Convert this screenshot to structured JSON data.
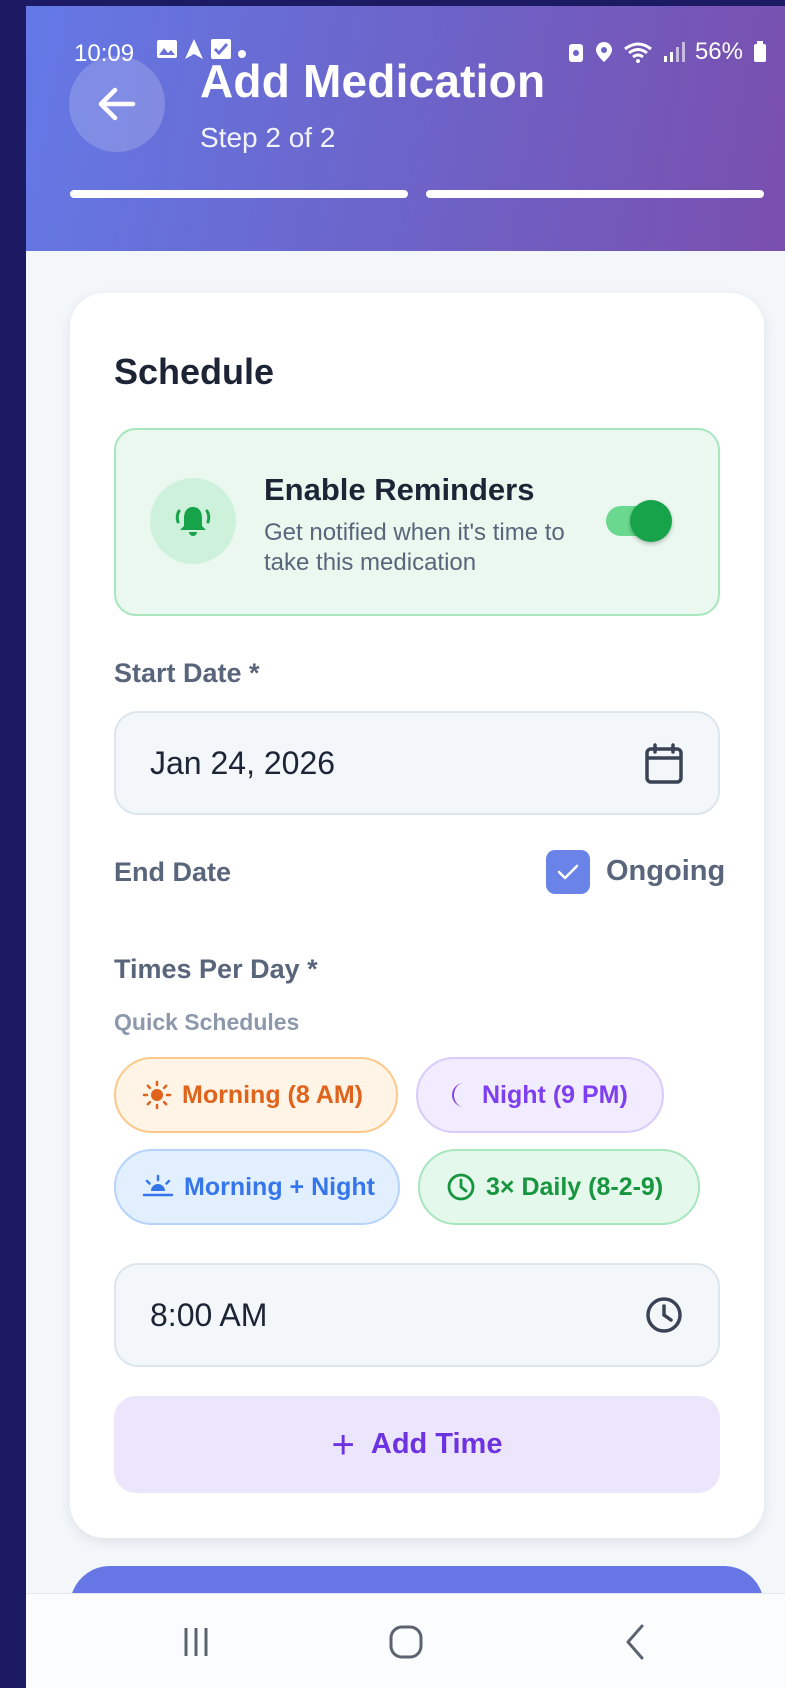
{
  "status_bar": {
    "time": "10:09",
    "battery": "56%"
  },
  "header": {
    "title": "Add Medication",
    "subtitle": "Step 2 of 2",
    "step_current": 2,
    "step_total": 2
  },
  "schedule": {
    "title": "Schedule",
    "reminders": {
      "title": "Enable Reminders",
      "description": "Get notified when it's time to take this medication",
      "enabled": true
    },
    "start_date": {
      "label": "Start Date *",
      "value": "Jan 24, 2026"
    },
    "end_date": {
      "label": "End Date",
      "ongoing_label": "Ongoing",
      "ongoing_checked": true
    },
    "times": {
      "label": "Times Per Day *",
      "quick_label": "Quick Schedules",
      "chips": [
        {
          "label": "Morning (8 AM)",
          "icon": "sun-icon"
        },
        {
          "label": "Night (9 PM)",
          "icon": "moon-icon"
        },
        {
          "label": "Morning + Night",
          "icon": "sunrise-icon"
        },
        {
          "label": "3× Daily (8-2-9)",
          "icon": "clock-icon"
        }
      ],
      "time_value": "8:00 AM",
      "add_time_label": "Add Time"
    }
  },
  "colors": {
    "header_start": "#6479e6",
    "header_end": "#7a4fae",
    "accent_green": "#17a34a",
    "accent_purple": "#6d33e1",
    "checkbox": "#6a83e8"
  }
}
